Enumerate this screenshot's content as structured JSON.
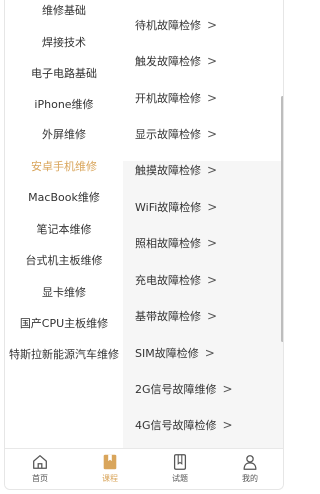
{
  "left_nav": {
    "items": [
      {
        "label": "维修基础"
      },
      {
        "label": "焊接技术"
      },
      {
        "label": "电子电路基础"
      },
      {
        "label": "iPhone维修"
      },
      {
        "label": "外屏维修"
      },
      {
        "label": "安卓手机维修"
      },
      {
        "label": "MacBook维修"
      },
      {
        "label": "笔记本维修"
      },
      {
        "label": "台式机主板维修"
      },
      {
        "label": "显卡维修"
      },
      {
        "label": "国产CPU主板维修"
      },
      {
        "label": "特斯拉新能源汽车维修"
      }
    ],
    "active_index": 5
  },
  "right_list": {
    "items": [
      {
        "label": "待机故障检修"
      },
      {
        "label": "触发故障检修"
      },
      {
        "label": "开机故障检修"
      },
      {
        "label": "显示故障检修"
      },
      {
        "label": "触摸故障检修"
      },
      {
        "label": "WiFi故障检修"
      },
      {
        "label": "照相故障检修"
      },
      {
        "label": "充电故障检修"
      },
      {
        "label": "基带故障检修"
      },
      {
        "label": "SIM故障检修"
      },
      {
        "label": "2G信号故障维修"
      },
      {
        "label": "4G信号故障检修"
      }
    ],
    "chevron": ">"
  },
  "tabbar": {
    "tabs": [
      {
        "label": "首页",
        "icon": "home-icon"
      },
      {
        "label": "课程",
        "icon": "course-icon"
      },
      {
        "label": "试题",
        "icon": "exam-icon"
      },
      {
        "label": "我的",
        "icon": "user-icon"
      }
    ],
    "active_index": 1
  },
  "colors": {
    "accent": "#d9a55b",
    "text": "#333333",
    "right_bg": "#f6f6f6"
  }
}
